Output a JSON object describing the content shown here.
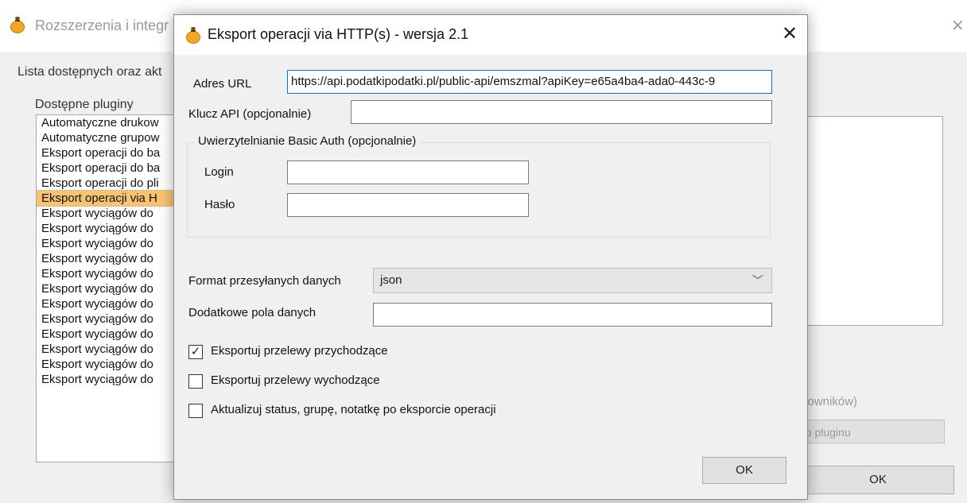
{
  "colors": {
    "selection": "#f9c472",
    "focus_border": "#0078d7",
    "dialog_bg": "#f0f0f0"
  },
  "background_window": {
    "title": "Rozszerzenia i integr",
    "close_icon": "close-icon",
    "description": "Lista dostępnych oraz akt",
    "plugins_label": "Dostępne pluginy",
    "plugins": [
      "Automatyczne drukow",
      "Automatyczne grupow",
      "Eksport operacji do ba",
      "Eksport operacji do ba",
      "Eksport operacji do pli",
      "Eksport operacji via H",
      "Eksport wyciągów do",
      "Eksport wyciągów do",
      "Eksport wyciągów do",
      "Eksport wyciągów do",
      "Eksport wyciągów do",
      "Eksport wyciągów do",
      "Eksport wyciągów do",
      "Eksport wyciągów do",
      "Eksport wyciągów do",
      "Eksport wyciągów do",
      "Eksport wyciągów do",
      "Eksport wyciągów do"
    ],
    "selected_index": 5,
    "fragment_1": "u",
    "fragment_2": "kowników)",
    "info_button": "no pluginu",
    "ok_button": "OK"
  },
  "dialog": {
    "title": "Eksport operacji via HTTP(s) - wersja 2.1",
    "url_label": "Adres URL",
    "url_value": "https://api.podatkipodatki.pl/public-api/emszmal?apiKey=e65a4ba4-ada0-443c-9",
    "api_key_label": "Klucz API (opcjonalnie)",
    "api_key_value": "",
    "basic_auth_legend": "Uwierzytelnianie Basic Auth (opcjonalnie)",
    "login_label": "Login",
    "login_value": "",
    "password_label": "Hasło",
    "password_value": "",
    "format_label": "Format przesyłanych danych",
    "format_value": "json",
    "extra_fields_label": "Dodatkowe pola danych",
    "extra_fields_value": "",
    "checkboxes": [
      {
        "label": "Eksportuj przelewy przychodzące",
        "checked": true
      },
      {
        "label": "Eksportuj przelewy wychodzące",
        "checked": false
      },
      {
        "label": "Aktualizuj status, grupę, notatkę po eksporcie operacji",
        "checked": false
      }
    ],
    "ok_button": "OK"
  }
}
